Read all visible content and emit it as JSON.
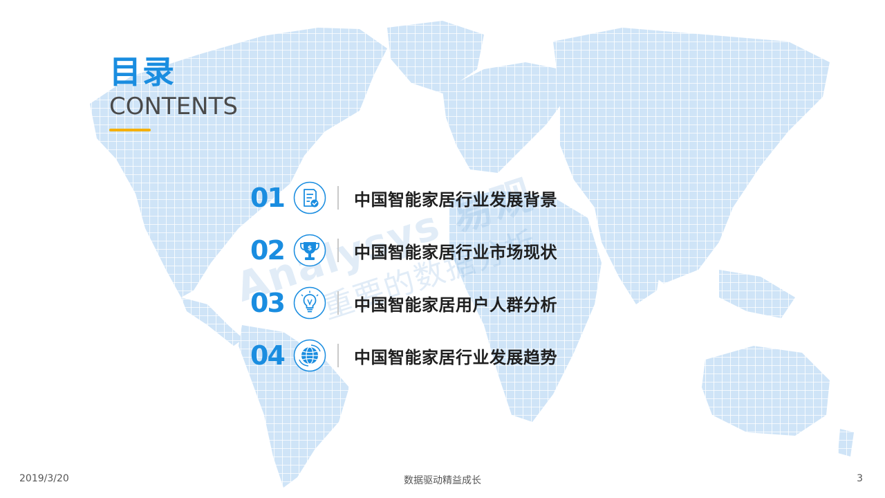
{
  "watermark": {
    "text": "Analysys 易观",
    "sub_text": "重要的数据分析"
  },
  "header": {
    "title_cn": "目录",
    "title_en": "CONTENTS"
  },
  "toc": {
    "items": [
      {
        "number": "01",
        "label": "中国智能家居行业发展背景",
        "icon": "document-check-icon"
      },
      {
        "number": "02",
        "label": "中国智能家居行业市场现状",
        "icon": "trophy-icon"
      },
      {
        "number": "03",
        "label": "中国智能家居用户人群分析",
        "icon": "lightbulb-icon"
      },
      {
        "number": "04",
        "label": "中国智能家居行业发展趋势",
        "icon": "globe-icon"
      }
    ]
  },
  "footer": {
    "date": "2019/3/20",
    "slogan": "数据驱动精益成长",
    "page_number": "3"
  },
  "colors": {
    "accent_blue": "#1a8de0",
    "accent_yellow": "#f5b000",
    "map_blue": "#cfe4f7",
    "text_dark": "#1f1f1f"
  }
}
